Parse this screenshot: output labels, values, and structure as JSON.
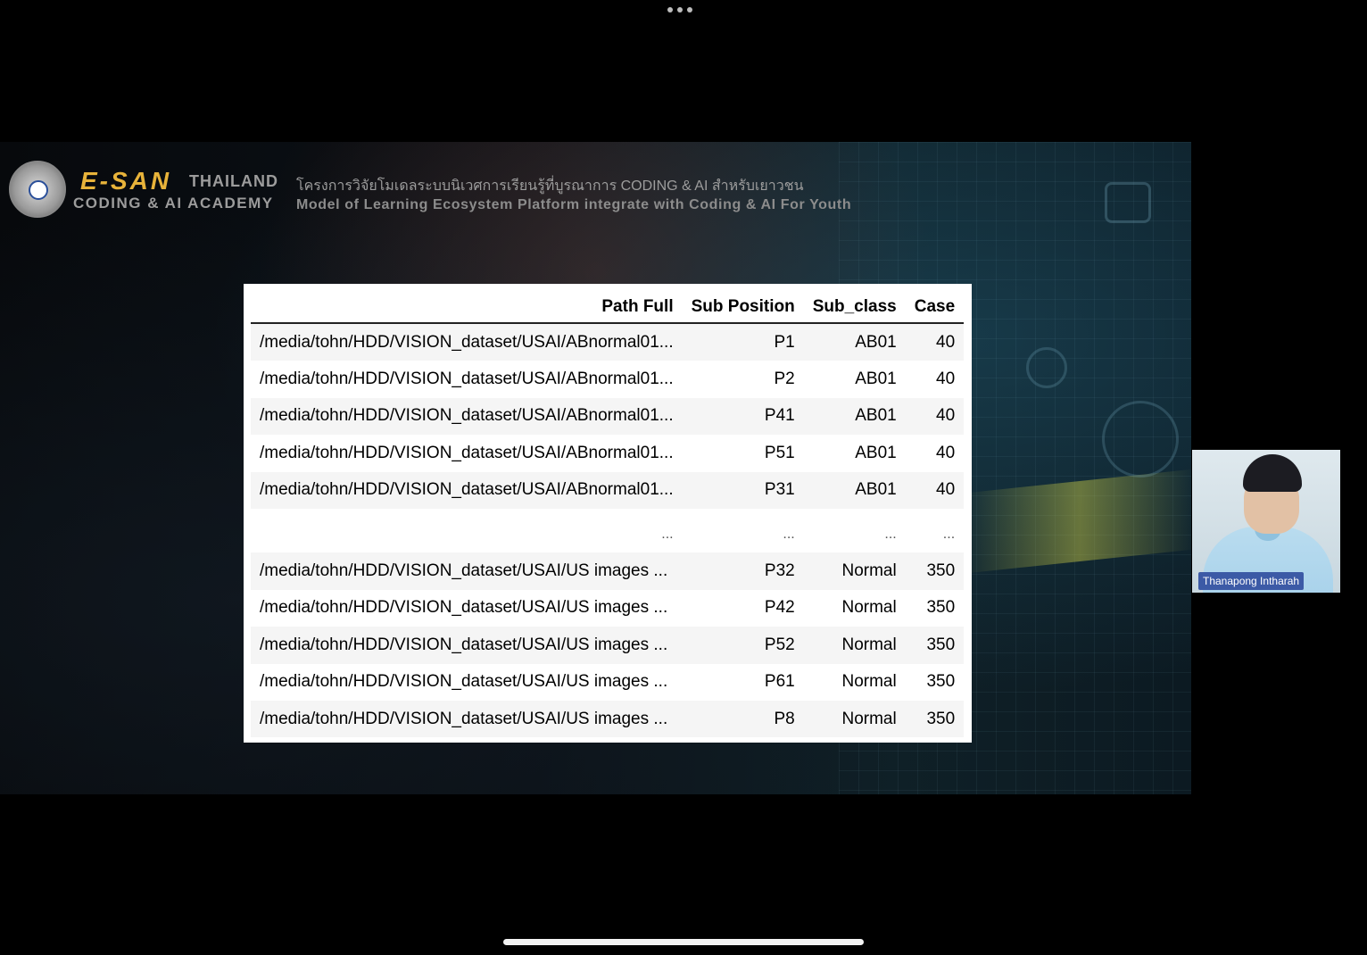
{
  "presentation": {
    "logo": {
      "brand_line": "E-SAN",
      "brand_suffix": "THAILAND",
      "brand_sub": "CODING & AI ACADEMY"
    },
    "header_thai": "โครงการวิจัยโมเดลระบบนิเวศการเรียนรู้ที่บูรณาการ CODING & AI สำหรับเยาวชน",
    "header_en": "Model of Learning Ecosystem Platform integrate with Coding & AI For Youth"
  },
  "table": {
    "columns": [
      "Path Full",
      "Sub Position",
      "Sub_class",
      "Case"
    ],
    "rows": [
      [
        "/media/tohn/HDD/VISION_dataset/USAI/ABnormal01...",
        "P1",
        "AB01",
        "40"
      ],
      [
        "/media/tohn/HDD/VISION_dataset/USAI/ABnormal01...",
        "P2",
        "AB01",
        "40"
      ],
      [
        "/media/tohn/HDD/VISION_dataset/USAI/ABnormal01...",
        "P41",
        "AB01",
        "40"
      ],
      [
        "/media/tohn/HDD/VISION_dataset/USAI/ABnormal01...",
        "P51",
        "AB01",
        "40"
      ],
      [
        "/media/tohn/HDD/VISION_dataset/USAI/ABnormal01...",
        "P31",
        "AB01",
        "40"
      ],
      [
        "...",
        "...",
        "...",
        "..."
      ],
      [
        "/media/tohn/HDD/VISION_dataset/USAI/US images ...",
        "P32",
        "Normal",
        "350"
      ],
      [
        "/media/tohn/HDD/VISION_dataset/USAI/US images ...",
        "P42",
        "Normal",
        "350"
      ],
      [
        "/media/tohn/HDD/VISION_dataset/USAI/US images ...",
        "P52",
        "Normal",
        "350"
      ],
      [
        "/media/tohn/HDD/VISION_dataset/USAI/US images ...",
        "P61",
        "Normal",
        "350"
      ],
      [
        "/media/tohn/HDD/VISION_dataset/USAI/US images ...",
        "P8",
        "Normal",
        "350"
      ]
    ]
  },
  "participant": {
    "name": "Thanapong Intharah"
  },
  "icons": {
    "more_options": "more-options-icon",
    "home_indicator": "home-indicator-bar"
  }
}
